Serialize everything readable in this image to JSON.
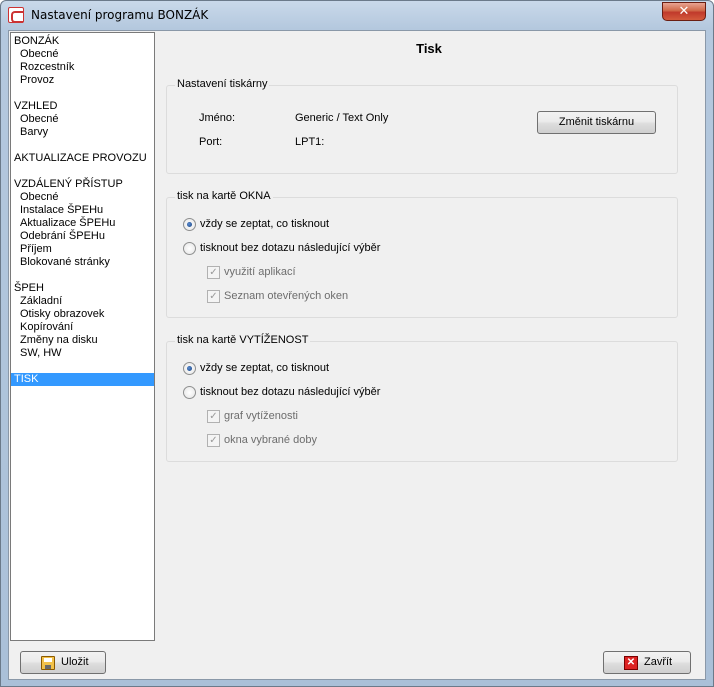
{
  "window": {
    "title": "Nastavení programu BONZÁK",
    "close_symbol": "✕"
  },
  "nav": {
    "items": [
      {
        "label": "BONZÁK",
        "level": 0,
        "selected": false
      },
      {
        "label": "Obecné",
        "level": 1,
        "selected": false
      },
      {
        "label": "Rozcestník",
        "level": 1,
        "selected": false
      },
      {
        "label": "Provoz",
        "level": 1,
        "selected": false
      },
      {
        "label": "VZHLED",
        "level": 0,
        "selected": false
      },
      {
        "label": "Obecné",
        "level": 1,
        "selected": false
      },
      {
        "label": "Barvy",
        "level": 1,
        "selected": false
      },
      {
        "label": "AKTUALIZACE PROVOZU",
        "level": 0,
        "selected": false
      },
      {
        "label": "VZDÁLENÝ PŘÍSTUP",
        "level": 0,
        "selected": false
      },
      {
        "label": "Obecné",
        "level": 1,
        "selected": false
      },
      {
        "label": "Instalace ŠPEHu",
        "level": 1,
        "selected": false
      },
      {
        "label": "Aktualizace ŠPEHu",
        "level": 1,
        "selected": false
      },
      {
        "label": "Odebrání ŠPEHu",
        "level": 1,
        "selected": false
      },
      {
        "label": "Příjem",
        "level": 1,
        "selected": false
      },
      {
        "label": "Blokované stránky",
        "level": 1,
        "selected": false
      },
      {
        "label": "ŠPEH",
        "level": 0,
        "selected": false
      },
      {
        "label": "Základní",
        "level": 1,
        "selected": false
      },
      {
        "label": "Otisky obrazovek",
        "level": 1,
        "selected": false
      },
      {
        "label": "Kopírování",
        "level": 1,
        "selected": false
      },
      {
        "label": "Změny na disku",
        "level": 1,
        "selected": false
      },
      {
        "label": "SW, HW",
        "level": 1,
        "selected": false
      },
      {
        "label": "TISK",
        "level": 0,
        "selected": true
      }
    ]
  },
  "main": {
    "heading": "Tisk",
    "printer": {
      "legend": "Nastavení tiskárny",
      "name_label": "Jméno:",
      "name_value": "Generic / Text Only",
      "port_label": "Port:",
      "port_value": "LPT1:",
      "change_button": "Změnit tiskárnu"
    },
    "okna": {
      "legend": "tisk na kartě OKNA",
      "option_ask": "vždy se zeptat, co tisknout",
      "option_direct": "tisknout bez dotazu následující výběr",
      "check1": "využití aplikací",
      "check2": "Seznam otevřených oken"
    },
    "vytizenost": {
      "legend": "tisk na kartě VYTÍŽENOST",
      "option_ask": "vždy se zeptat, co tisknout",
      "option_direct": "tisknout bez dotazu následující výběr",
      "check1": "graf vytíženosti",
      "check2": "okna vybrané doby"
    }
  },
  "footer": {
    "save_label": "Uložit",
    "close_label": "Zavřít"
  }
}
